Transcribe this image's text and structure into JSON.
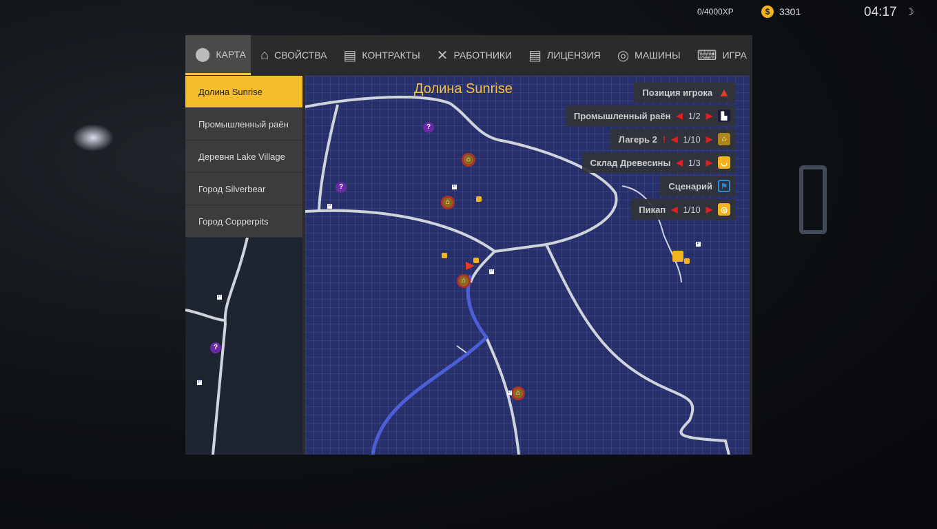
{
  "hud": {
    "xp": "0/4000XP",
    "money": "3301",
    "coin_icon": "$",
    "time": "04:17",
    "moon_icon": "☽"
  },
  "tabs": [
    {
      "label": "КАРТА",
      "icon": "map-pin"
    },
    {
      "label": "СВОЙСТВА",
      "icon": "house"
    },
    {
      "label": "КОНТРАКТЫ",
      "icon": "notebook"
    },
    {
      "label": "РАБОТНИКИ",
      "icon": "tools"
    },
    {
      "label": "ЛИЦЕНЗИЯ",
      "icon": "notebook"
    },
    {
      "label": "МАШИНЫ",
      "icon": "steering-wheel"
    },
    {
      "label": "ИГРА",
      "icon": "keyboard"
    }
  ],
  "regions": [
    "Долина Sunrise",
    "Промышленный раён",
    "Деревня Lake Village",
    "Город Silverbear",
    "Город Copperpits"
  ],
  "map": {
    "title": "Долина Sunrise",
    "legend": {
      "player": "Позиция игрока",
      "industrial": {
        "label": "Промышленный раён",
        "count": "1/2"
      },
      "camp": {
        "label": "Лагерь 2",
        "alert": "!",
        "count": "1/10"
      },
      "lumber": {
        "label": "Склад Древесины",
        "count": "1/3"
      },
      "scenario": {
        "label": "Сценарий"
      },
      "pickup": {
        "label": "Пикап",
        "count": "1/10"
      }
    },
    "marker_glyphs": {
      "question": "?",
      "parking": "P",
      "house": "⌂"
    }
  }
}
